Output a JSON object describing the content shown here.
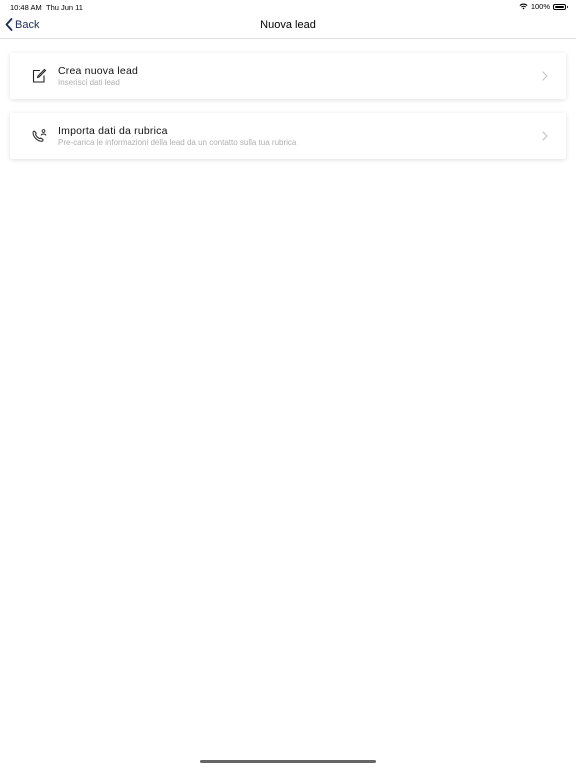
{
  "status_bar": {
    "time": "10:48 AM",
    "date": "Thu Jun 11",
    "battery": "100%",
    "wifi_icon": "wifi-icon",
    "battery_icon": "battery-icon"
  },
  "nav": {
    "back_label": "Back",
    "title": "Nuova lead"
  },
  "options": [
    {
      "title": "Crea nuova lead",
      "subtitle": "Inserisci dati lead",
      "icon": "edit-icon"
    },
    {
      "title": "Importa dati da rubrica",
      "subtitle": "Pre-carica le informazioni della lead da un contatto sulla tua rubrica",
      "icon": "phone-contact-icon"
    }
  ],
  "colors": {
    "accent": "#1f2a5a",
    "subtitle": "#b0b0b0"
  }
}
